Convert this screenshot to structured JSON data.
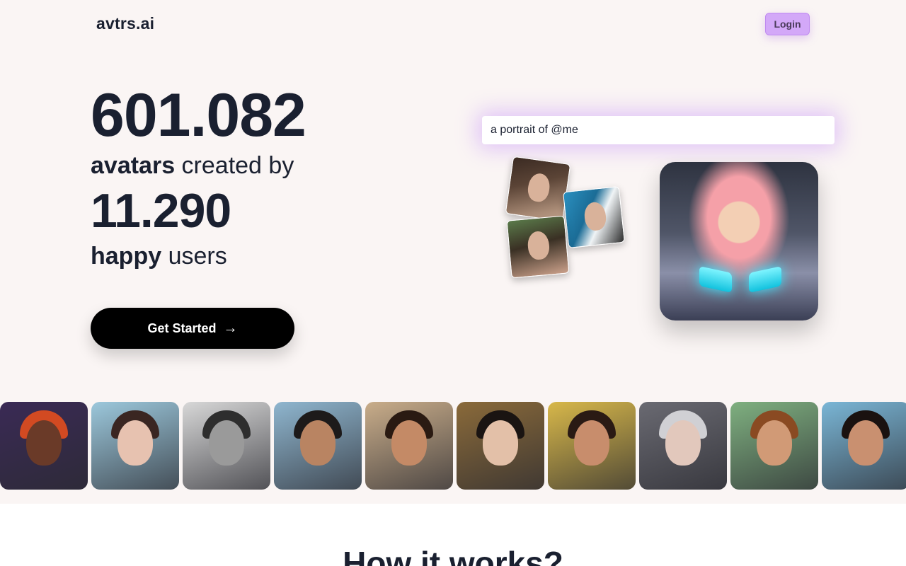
{
  "header": {
    "logo": "avtrs.ai",
    "login_label": "Login"
  },
  "hero": {
    "avatars_count": "601.082",
    "line1_bold": "avatars",
    "line1_rest": " created by",
    "users_count": "11.290",
    "line2_bold": "happy",
    "line2_rest": " users",
    "cta_label": "Get Started",
    "cta_icon": "arrow-right-icon"
  },
  "demo": {
    "prompt_value": "a portrait of @me",
    "accent_glow": "#be82fa"
  },
  "gallery": {
    "tiles": [
      {
        "name": "gallery-avatar-1",
        "bg": "#3a2a55",
        "skin": "#6a3a28",
        "hair": "#d24a22"
      },
      {
        "name": "gallery-avatar-2",
        "bg": "#9cc8dc",
        "skin": "#e7c2b0",
        "hair": "#3a2622"
      },
      {
        "name": "gallery-avatar-3",
        "bg": "#d8d8d8",
        "skin": "#9a9a9a",
        "hair": "#2e2e2e"
      },
      {
        "name": "gallery-avatar-4",
        "bg": "#8fb6cf",
        "skin": "#b98462",
        "hair": "#1d1a1a"
      },
      {
        "name": "gallery-avatar-5",
        "bg": "#c9ad8a",
        "skin": "#c48a66",
        "hair": "#2a1a12"
      },
      {
        "name": "gallery-avatar-6",
        "bg": "#8a6a3a",
        "skin": "#e3c0a8",
        "hair": "#1a1412"
      },
      {
        "name": "gallery-avatar-7",
        "bg": "#d8b84a",
        "skin": "#c88d6c",
        "hair": "#2a1a14"
      },
      {
        "name": "gallery-avatar-8",
        "bg": "#6a6a72",
        "skin": "#e2c8bc",
        "hair": "#d0d0d4"
      },
      {
        "name": "gallery-avatar-9",
        "bg": "#7fb080",
        "skin": "#d19a76",
        "hair": "#8a4a22"
      },
      {
        "name": "gallery-avatar-10",
        "bg": "#7ab6d6",
        "skin": "#c99070",
        "hair": "#1a1210"
      }
    ]
  },
  "section": {
    "how_title": "How it works?"
  }
}
